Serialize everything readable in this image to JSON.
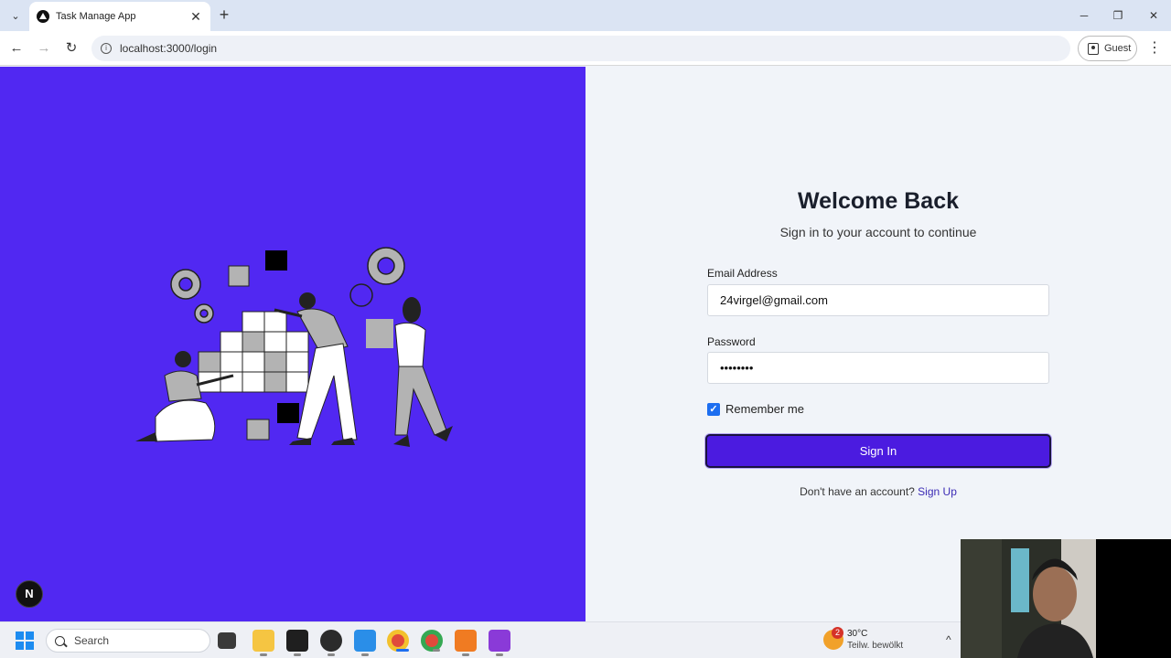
{
  "browser": {
    "tab_title": "Task Manage App",
    "url": "localhost:3000/login",
    "profile_label": "Guest",
    "glyphs": {
      "tab_menu": "⌄",
      "tab_close": "✕",
      "new_tab": "+",
      "minimize": "─",
      "restore": "❐",
      "close": "✕",
      "back": "←",
      "forward": "→",
      "reload": "↻",
      "site_info": "i",
      "menu": "⋮"
    }
  },
  "login": {
    "title": "Welcome Back",
    "subtitle": "Sign in to your account to continue",
    "email_label": "Email Address",
    "email_value": "24virgel@gmail.com",
    "password_label": "Password",
    "password_value": "••••••••",
    "remember_label": "Remember me",
    "remember_checked": true,
    "remember_mark": "✓",
    "signin_label": "Sign In",
    "signup_prompt": "Don't have an account?",
    "signup_link": "Sign Up"
  },
  "dev_badge": "N",
  "taskbar": {
    "search_label": "Search",
    "weather_temp": "30°C",
    "weather_desc": "Teilw. bewölkt",
    "weather_badge": "2",
    "tray_chevron": "^"
  },
  "colors": {
    "illustration_panel": "#5128f2",
    "signin_button": "#4b1be0",
    "signup_link": "#3b2bb5",
    "checkbox": "#1d6ef0"
  }
}
